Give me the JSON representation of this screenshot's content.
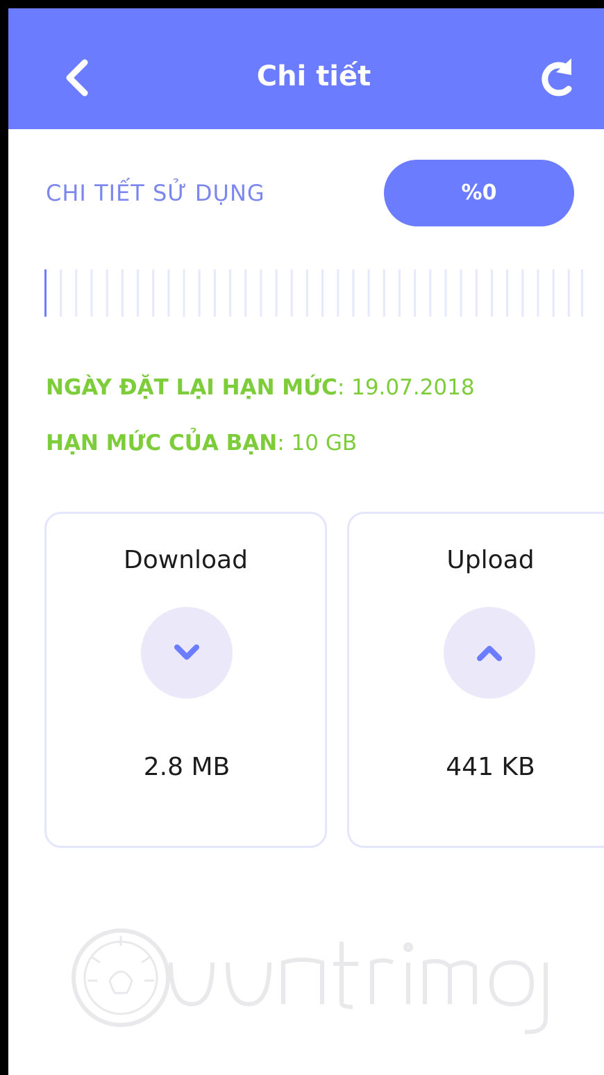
{
  "header": {
    "title": "Chi tiết",
    "back_icon": "chevron-left-icon",
    "refresh_icon": "refresh-icon",
    "background_color": "#6b7cff"
  },
  "usage": {
    "label": "CHI TIẾT SỬ DỤNG",
    "percent_text": "%0",
    "progress_fraction": 0,
    "progress_fill_color": "#6b7cff",
    "progress_track_color": "#e6e8fc"
  },
  "info": {
    "reset_label": "NGÀY ĐẶT LẠI HẠN MỨC",
    "reset_value": ": 19.07.2018",
    "limit_label": "HẠN MỨC CỦA BẠN",
    "limit_value": ": 10 GB",
    "color": "#7dcc3a"
  },
  "cards": {
    "download": {
      "title": "Download",
      "icon": "chevron-down-icon",
      "value": "2.8 MB"
    },
    "upload": {
      "title": "Upload",
      "icon": "chevron-up-icon",
      "value": "441 KB"
    }
  },
  "watermark": {
    "text": "Quantrimang"
  }
}
